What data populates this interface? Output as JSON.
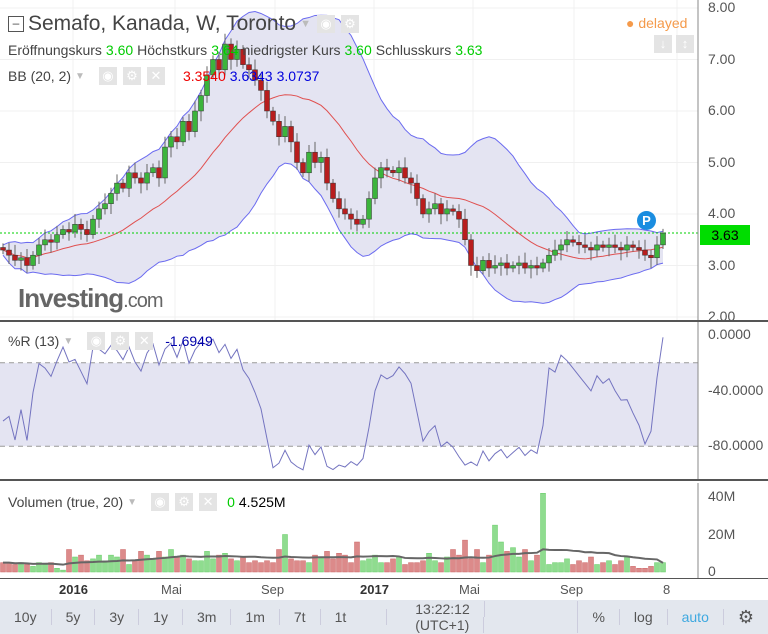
{
  "header": {
    "title": "Semafo, Kanada, W, Toronto",
    "status": "delayed",
    "ohlc": [
      {
        "label": "Eröffnungskurs",
        "value": "3.60"
      },
      {
        "label": "Höchstkurs",
        "value": "3.64"
      },
      {
        "label": "niedrigster Kurs",
        "value": "3.60"
      },
      {
        "label": "Schlusskurs",
        "value": "3.63"
      }
    ]
  },
  "bb": {
    "label": "BB (20, 2)",
    "mid": "3.3540",
    "upper": "3.6343",
    "lower": "3.0737"
  },
  "wr": {
    "label": "%R (13)",
    "value": "-1.6949"
  },
  "vol": {
    "label": "Volumen (true, 20)",
    "v0": "0",
    "value": "4.525M"
  },
  "price_axis": [
    "8.00",
    "7.00",
    "6.00",
    "5.00",
    "4.00",
    "3.00",
    "2.00"
  ],
  "last_price": "3.63",
  "wr_axis": [
    "0.0000",
    "-40.0000",
    "-80.0000"
  ],
  "vol_axis": [
    "40M",
    "20M",
    "0"
  ],
  "time_axis": [
    {
      "t": "2016",
      "b": true
    },
    {
      "t": "Mai"
    },
    {
      "t": "Sep"
    },
    {
      "t": "2017",
      "b": true
    },
    {
      "t": "Mai"
    },
    {
      "t": "Sep"
    },
    {
      "t": "8"
    }
  ],
  "toolbar": {
    "ranges": [
      "10y",
      "5y",
      "3y",
      "1y",
      "3m",
      "1m",
      "7t",
      "1t"
    ],
    "time": "13:22:12",
    "tz": "(UTC+1)",
    "pct": "%",
    "log": "log",
    "auto": "auto"
  },
  "watermark": "Investing.com",
  "colors": {
    "up": "#3cb43c",
    "down": "#b81d1d",
    "bb": "#6b6bf0",
    "mid": "#e05050",
    "wr": "#7474c0",
    "last": "#00d000",
    "accent": "#3fa9e0"
  },
  "chart_data": {
    "type": "candlestick",
    "close": [
      3.3,
      3.2,
      3.1,
      3.15,
      3.0,
      3.2,
      3.4,
      3.5,
      3.45,
      3.6,
      3.7,
      3.65,
      3.8,
      3.7,
      3.6,
      3.9,
      4.1,
      4.2,
      4.4,
      4.6,
      4.5,
      4.8,
      4.7,
      4.6,
      4.8,
      4.9,
      4.7,
      5.3,
      5.5,
      5.4,
      5.8,
      5.6,
      6.0,
      6.3,
      6.7,
      7.0,
      6.8,
      7.3,
      7.0,
      7.2,
      6.9,
      6.8,
      6.6,
      6.4,
      6.0,
      5.8,
      5.5,
      5.7,
      5.4,
      5.0,
      4.8,
      5.2,
      5.0,
      5.1,
      4.6,
      4.3,
      4.1,
      4.0,
      3.9,
      3.8,
      3.9,
      4.3,
      4.7,
      4.9,
      4.85,
      4.8,
      4.9,
      4.7,
      4.6,
      4.3,
      4.0,
      4.1,
      4.2,
      4.0,
      4.1,
      4.05,
      3.9,
      3.5,
      3.0,
      2.9,
      3.1,
      2.95,
      3.0,
      3.05,
      2.95,
      3.0,
      3.05,
      2.95,
      3.0,
      2.95,
      3.05,
      3.2,
      3.3,
      3.4,
      3.5,
      3.45,
      3.4,
      3.35,
      3.3,
      3.4,
      3.35,
      3.4,
      3.35,
      3.3,
      3.4,
      3.35,
      3.3,
      3.2,
      3.15,
      3.4,
      3.63
    ],
    "volume_m": [
      5,
      5,
      4,
      5,
      4,
      3,
      5,
      4,
      5,
      2,
      1,
      12,
      8,
      9,
      6,
      7,
      9,
      6,
      9,
      8,
      12,
      4,
      6,
      11,
      9,
      7,
      11,
      8,
      12,
      8,
      9,
      7,
      6,
      6,
      11,
      7,
      9,
      10,
      7,
      6,
      8,
      5,
      6,
      5,
      6,
      5,
      12,
      20,
      7,
      6,
      6,
      5,
      9,
      8,
      11,
      7,
      10,
      9,
      5,
      16,
      6,
      7,
      9,
      5,
      5,
      7,
      8,
      4,
      5,
      5,
      6,
      10,
      6,
      5,
      8,
      12,
      9,
      17,
      7,
      12,
      5,
      9,
      25,
      16,
      11,
      13,
      8,
      12,
      6,
      9,
      42,
      4,
      5,
      5,
      7,
      4,
      6,
      5,
      8,
      4,
      5,
      6,
      4,
      6,
      8,
      3,
      2,
      2,
      3,
      5,
      5,
      4,
      3,
      3,
      2,
      8,
      5
    ],
    "bb_period": 20,
    "bb_mult": 2,
    "wr_period": 13,
    "ylim": [
      2,
      8
    ],
    "wr_lim": [
      -100,
      0
    ],
    "vol_lim": [
      0,
      45
    ]
  }
}
